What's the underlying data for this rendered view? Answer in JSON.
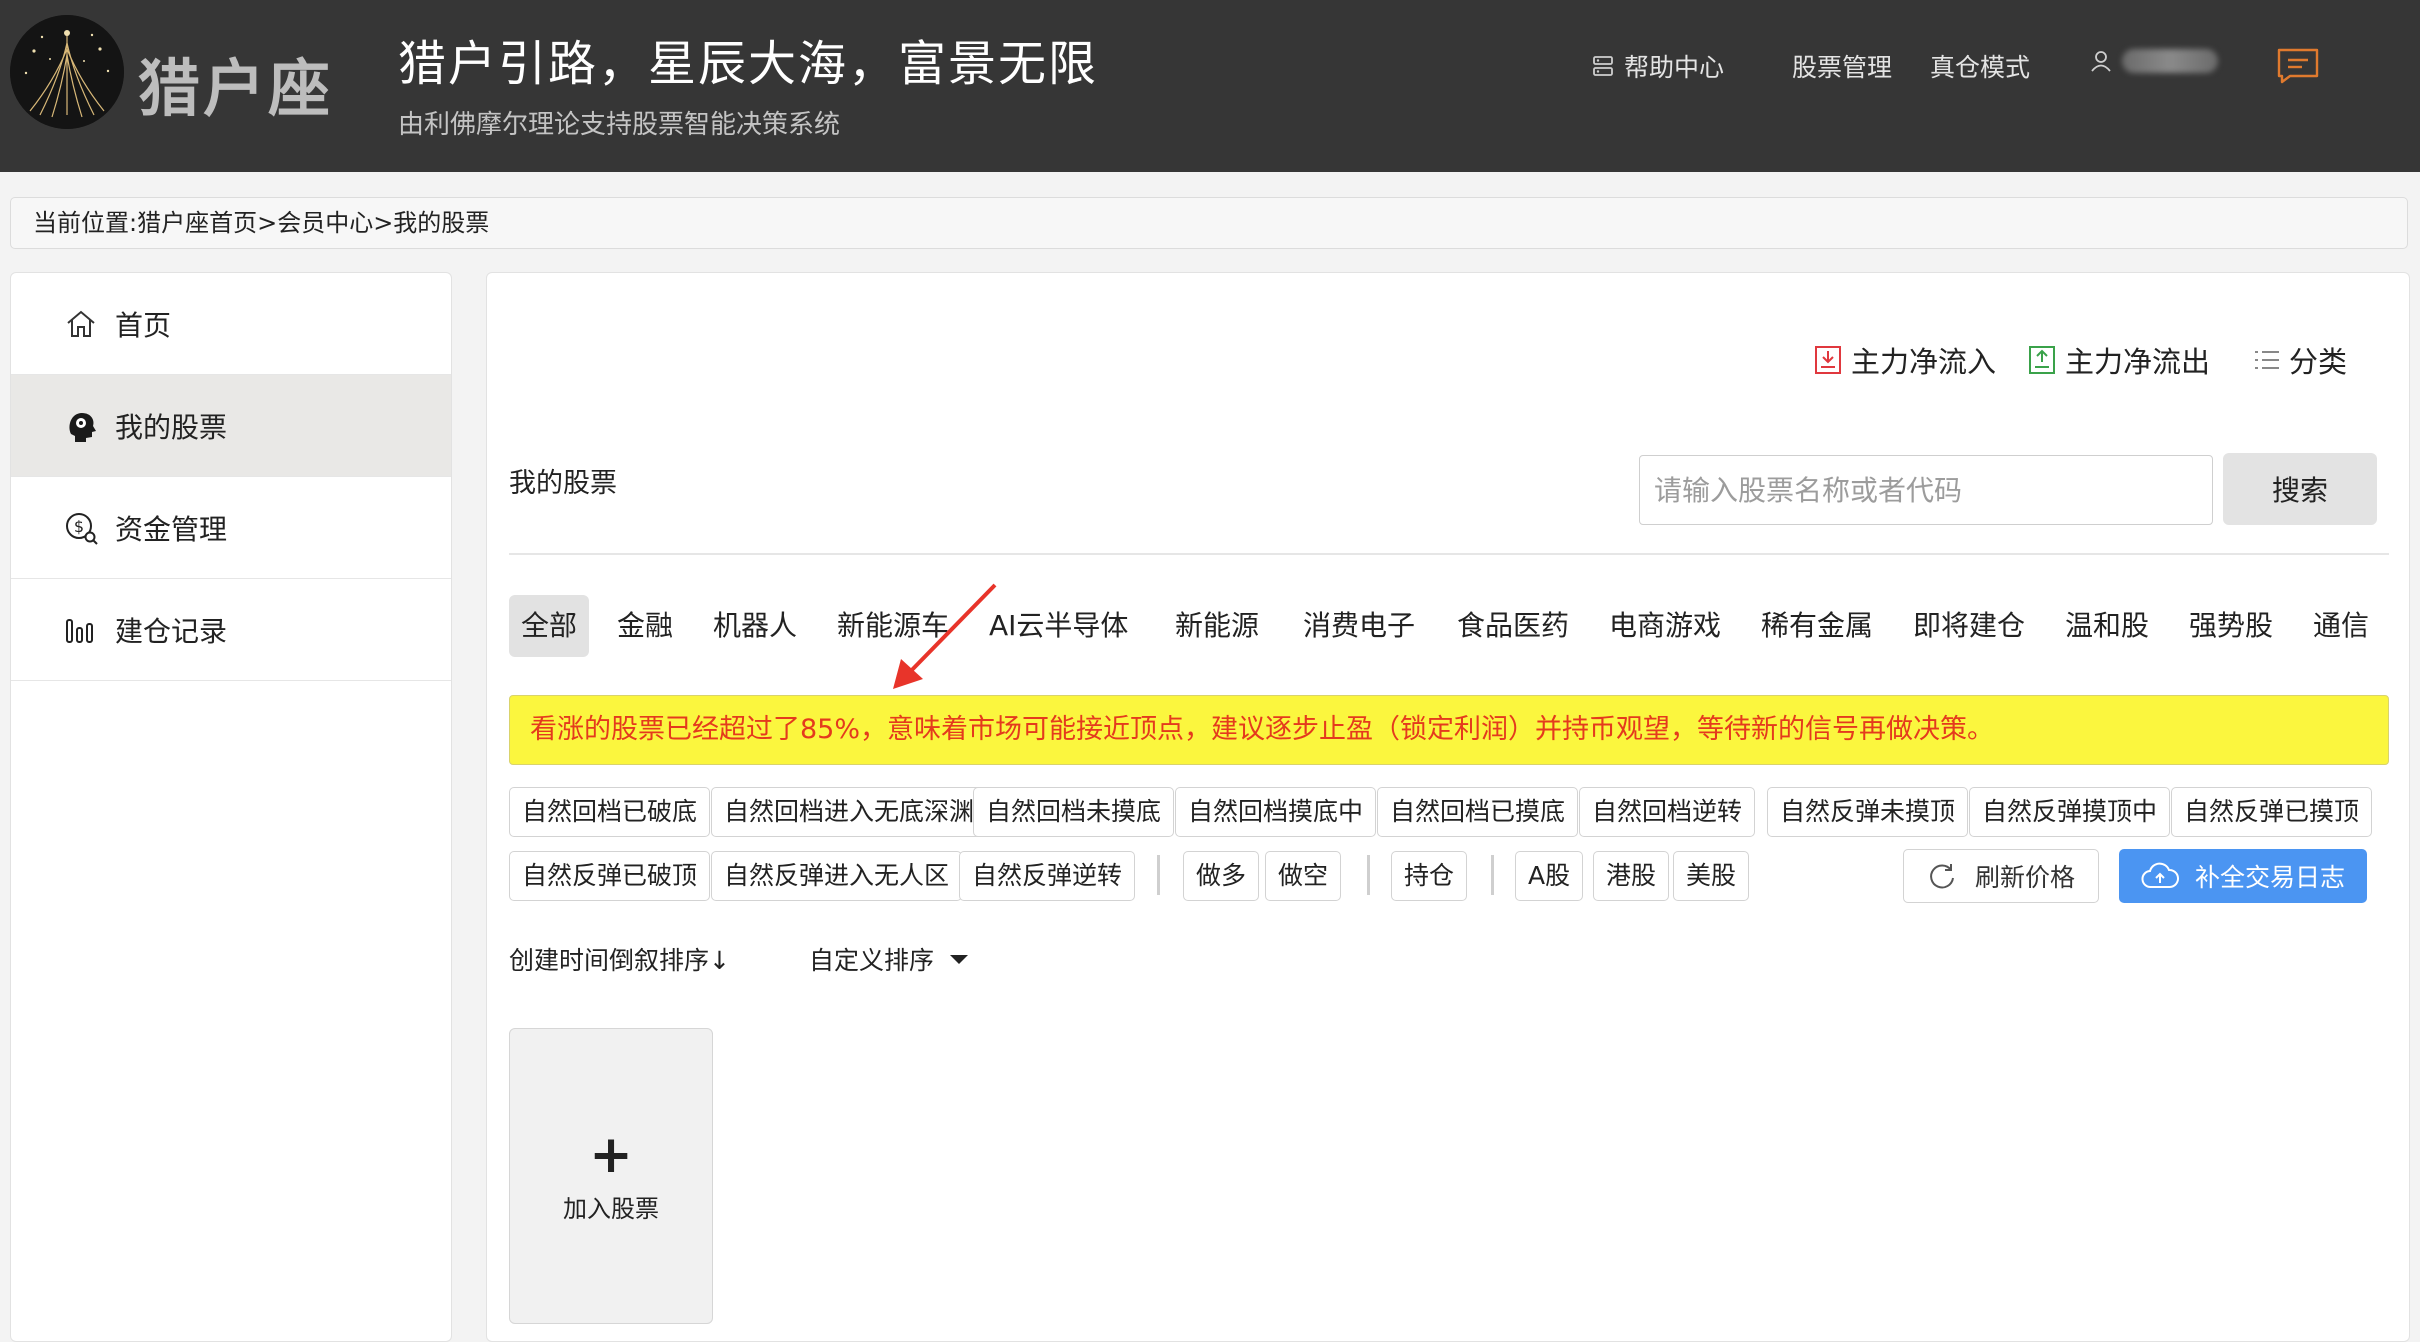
{
  "header": {
    "logo_text": "猎户座",
    "slogan": "猎户引路，星辰大海，富景无限",
    "subslogan": "由利佛摩尔理论支持股票智能决策系统",
    "nav": {
      "help": "帮助中心",
      "stock_manage": "股票管理",
      "real_mode": "真仓模式"
    }
  },
  "breadcrumb": "当前位置:猎户座首页>会员中心>我的股票",
  "sidebar": {
    "items": [
      {
        "label": "首页",
        "icon": "home-icon"
      },
      {
        "label": "我的股票",
        "icon": "head-brain-icon"
      },
      {
        "label": "资金管理",
        "icon": "money-search-icon"
      },
      {
        "label": "建仓记录",
        "icon": "bar-chart-icon"
      }
    ],
    "active": "我的股票"
  },
  "main": {
    "actions": {
      "inflow": "主力净流入",
      "outflow": "主力净流出",
      "classify": "分类"
    },
    "title": "我的股票",
    "search": {
      "placeholder": "请输入股票名称或者代码",
      "button": "搜索"
    },
    "categories": [
      "全部",
      "金融",
      "机器人",
      "新能源车",
      "AI云半导体",
      "新能源",
      "消费电子",
      "食品医药",
      "电商游戏",
      "稀有金属",
      "即将建仓",
      "温和股",
      "强势股",
      "通信"
    ],
    "active_category": "全部",
    "notice": "看涨的股票已经超过了85%，意味着市场可能接近顶点，建议逐步止盈（锁定利润）并持币观望，等待新的信号再做决策。",
    "filters_row1": [
      "自然回档已破底",
      "自然回档进入无底深渊",
      "自然回档未摸底",
      "自然回档摸底中",
      "自然回档已摸底",
      "自然回档逆转",
      "自然反弹未摸顶",
      "自然反弹摸顶中",
      "自然反弹已摸顶"
    ],
    "filters_row2_group1": [
      "自然反弹已破顶",
      "自然反弹进入无人区",
      "自然反弹逆转"
    ],
    "filters_row2_group2": [
      "做多",
      "做空"
    ],
    "filters_row2_group3": [
      "持仓"
    ],
    "filters_row2_group4": [
      "A股",
      "港股",
      "美股"
    ],
    "refresh_button": "刷新价格",
    "log_button": "补全交易日志",
    "sort": {
      "time_desc": "创建时间倒叙排序↓",
      "custom": "自定义排序"
    },
    "add_card_label": "加入股票",
    "add_card_symbol": "+",
    "colors": {
      "notice_bg": "#fbf63e",
      "notice_text": "#e43a1d",
      "primary_button": "#4b95f2",
      "header_bg": "#363636"
    }
  }
}
